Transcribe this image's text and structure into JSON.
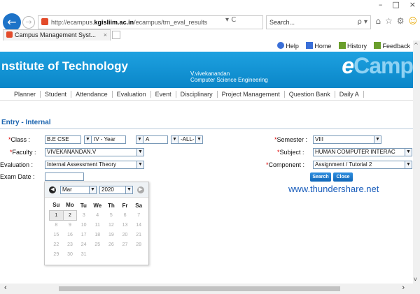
{
  "browser": {
    "window_controls": [
      "–",
      "□",
      "×"
    ],
    "back_glyph": "←",
    "forward_glyph": "→",
    "url_prefix": "http://ecampus.",
    "url_host": "kgisliim.ac.in",
    "url_path": "/ecampus/trn_eval_results",
    "address_tools": "▾ C",
    "search_placeholder": "Search...",
    "search_glyph": "ρ ▾",
    "toolbar_icons": [
      "home-icon",
      "star-icon",
      "gear-icon",
      "smiley-icon"
    ],
    "tab_title": "Campus Management Syst...",
    "tab_close": "×"
  },
  "toplinks": {
    "help": "Help",
    "home": "Home",
    "history": "History",
    "feedback": "Feedback"
  },
  "banner": {
    "institute": "nstitute of Technology",
    "user_name": "V.vivekanandan",
    "department": "Computer Science Engineering",
    "logo_e": "e",
    "logo_text": "Camp"
  },
  "menu": [
    "Planner",
    "Student",
    "Attendance",
    "Evaluation",
    "Event",
    "Disciplinary",
    "Project Management",
    "Question Bank",
    "Daily A"
  ],
  "section_title": "Entry - Internal",
  "form": {
    "class_label": "Class :",
    "class_value": "B.E CSE",
    "year_value": "IV - Year",
    "section_value": "A",
    "batch_value": "-ALL-",
    "semester_label": "Semester :",
    "semester_value": "VIII",
    "faculty_label": "Faculty :",
    "faculty_value": "VIVEKANANDAN.V",
    "subject_label": "Subject :",
    "subject_value": "HUMAN COMPUTER INTERAC",
    "evaluation_label": "Evaluation :",
    "evaluation_value": "Internal Assessment Theory",
    "component_label": "Component :",
    "component_value": "Assignment / Tutorial 2",
    "exam_date_label": "Exam Date :",
    "exam_date_value": "",
    "req_mark": "*"
  },
  "buttons": {
    "search": "Search",
    "close": "Close"
  },
  "watermark": "www.thundershare.net",
  "datepicker": {
    "prev": "◀",
    "next": "▶",
    "month": "Mar",
    "year": "2020",
    "weekdays": [
      "Su",
      "Mo",
      "Tu",
      "We",
      "Th",
      "Fr",
      "Sa"
    ],
    "weeks": [
      [
        "1",
        "2",
        "3",
        "4",
        "5",
        "6",
        "7"
      ],
      [
        "8",
        "9",
        "10",
        "11",
        "12",
        "13",
        "14"
      ],
      [
        "15",
        "16",
        "17",
        "18",
        "19",
        "20",
        "21"
      ],
      [
        "22",
        "23",
        "24",
        "25",
        "26",
        "27",
        "28"
      ],
      [
        "29",
        "30",
        "31",
        "",
        "",
        "",
        ""
      ]
    ]
  },
  "scroll": {
    "left": "‹",
    "right": "›",
    "up": "^",
    "down": "v"
  },
  "colors": {
    "banner": "#0a86c8",
    "section_title": "#1c65b0",
    "button": "#1167b8",
    "watermark": "#1a5dbb"
  }
}
